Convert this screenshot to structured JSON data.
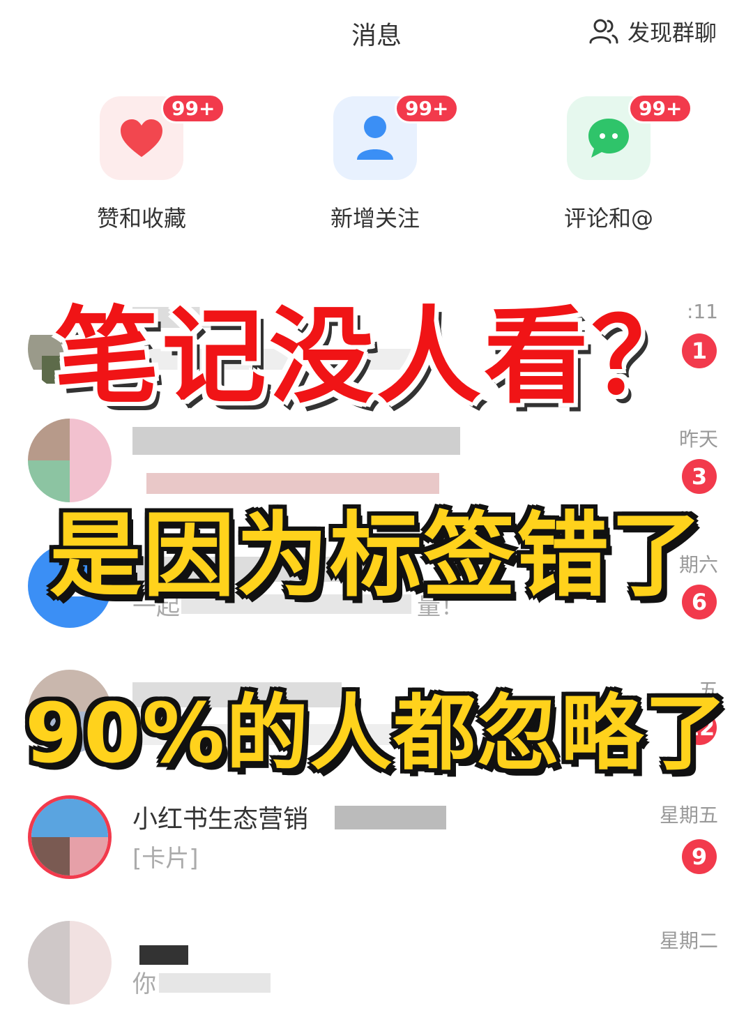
{
  "header": {
    "title": "消息",
    "discover_label": "发现群聊",
    "discover_icon": "group-people-icon"
  },
  "categories": [
    {
      "label": "赞和收藏",
      "badge": "99+",
      "icon": "heart-icon",
      "color": "#f2474f",
      "bg": "#fdecec"
    },
    {
      "label": "新增关注",
      "badge": "99+",
      "icon": "person-icon",
      "color": "#3b8ff5",
      "bg": "#e8f1fe"
    },
    {
      "label": "评论和@",
      "badge": "99+",
      "icon": "chat-bubble-icon",
      "color": "#2fc46a",
      "bg": "#e6f8ee"
    }
  ],
  "rows": [
    {
      "time": ":11",
      "name": "",
      "preview": "",
      "count": "1"
    },
    {
      "time": "昨天",
      "name": "",
      "preview": "",
      "count": "3"
    },
    {
      "time": "期六",
      "name": "",
      "preview": "一起",
      "preview_tail": "量！",
      "count": "6"
    },
    {
      "time": "五",
      "name": "",
      "preview": "",
      "count": "12"
    },
    {
      "time": "星期五",
      "name": "小红书生态营销",
      "preview": "[卡片]",
      "count": "9"
    },
    {
      "time": "星期二",
      "name": "",
      "preview": "你",
      "count": ""
    }
  ],
  "overlay": {
    "line1": "笔记没人看？",
    "line2": "是因为标签错了",
    "line3": "90%的人都忽略了"
  },
  "colors": {
    "badge_red": "#f23a4c",
    "headline_red": "#f01416",
    "headline_yellow": "#ffd21c"
  }
}
